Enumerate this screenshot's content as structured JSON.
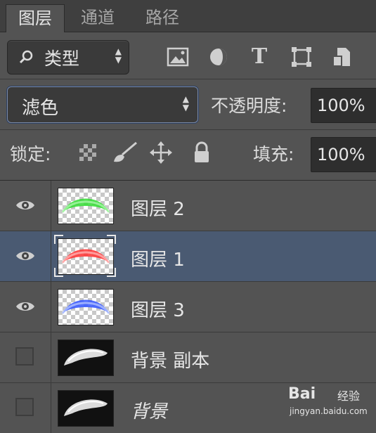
{
  "tabs": [
    {
      "label": "图层",
      "active": true
    },
    {
      "label": "通道",
      "active": false
    },
    {
      "label": "路径",
      "active": false
    }
  ],
  "filter": {
    "kind_label": "类型",
    "icons": [
      "image-filter-icon",
      "adjustment-filter-icon",
      "type-filter-icon",
      "shape-filter-icon",
      "smart-object-filter-icon"
    ],
    "type_glyph": "T"
  },
  "blend": {
    "mode": "滤色",
    "opacity_label": "不透明度:",
    "opacity_value": "100%"
  },
  "lock": {
    "label": "锁定:",
    "icons": [
      "lock-transparent-icon",
      "lock-paint-icon",
      "lock-position-icon",
      "lock-all-icon"
    ],
    "fill_label": "填充:",
    "fill_value": "100%"
  },
  "layers": [
    {
      "name": "图层 2",
      "visible": true,
      "selected": false,
      "thumb_color": "#33dd33"
    },
    {
      "name": "图层 1",
      "visible": true,
      "selected": true,
      "thumb_color": "#ff3333"
    },
    {
      "name": "图层 3",
      "visible": true,
      "selected": false,
      "thumb_color": "#3355ff"
    },
    {
      "name": "背景 副本",
      "visible": false,
      "selected": false,
      "thumb_color": "#dddddd"
    },
    {
      "name": "背景",
      "visible": false,
      "selected": false,
      "thumb_color": "#dddddd"
    }
  ],
  "watermark": {
    "brand": "Bai",
    "brand2": "经验",
    "url": "jingyan.baidu.com"
  },
  "colors": {
    "panel_bg": "#535353",
    "selected_row": "#4a5a72"
  }
}
